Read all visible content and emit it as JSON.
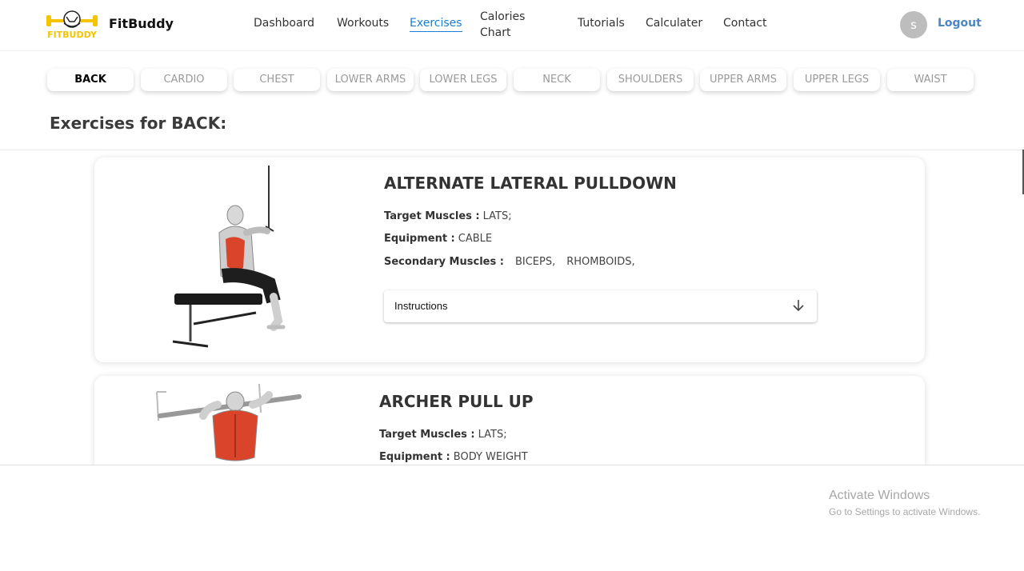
{
  "brand": {
    "name": "FitBuddy",
    "logo_text": "FITBUDDY"
  },
  "nav": {
    "items": [
      {
        "label": "Dashboard"
      },
      {
        "label": "Workouts"
      },
      {
        "label": "Exercises",
        "active": true
      },
      {
        "label": "Calories Chart"
      },
      {
        "label": "Tutorials"
      },
      {
        "label": "Calculater"
      },
      {
        "label": "Contact"
      }
    ],
    "avatar_initial": "s",
    "logout_label": "Logout"
  },
  "categories": [
    {
      "label": "BACK",
      "active": true
    },
    {
      "label": "CARDIO"
    },
    {
      "label": "CHEST"
    },
    {
      "label": "LOWER ARMS"
    },
    {
      "label": "LOWER LEGS"
    },
    {
      "label": "NECK"
    },
    {
      "label": "SHOULDERS"
    },
    {
      "label": "UPPER ARMS"
    },
    {
      "label": "UPPER LEGS"
    },
    {
      "label": "WAIST"
    }
  ],
  "section_title": "Exercises for BACK:",
  "labels": {
    "target": "Target Muscles :",
    "equipment": "Equipment :",
    "secondary": "Secondary Muscles :",
    "instructions": "Instructions"
  },
  "exercises": [
    {
      "name": "ALTERNATE LATERAL PULLDOWN",
      "target": "LATS;",
      "equipment": "CABLE",
      "secondary": [
        "BICEPS,",
        "RHOMBOIDS,"
      ]
    },
    {
      "name": "ARCHER PULL UP",
      "target": "LATS;",
      "equipment": "BODY WEIGHT"
    }
  ],
  "watermark": {
    "title": "Activate Windows",
    "subtitle": "Go to Settings to activate Windows."
  },
  "colors": {
    "accent": "#1a7fd4",
    "logout": "#4a86c5",
    "logo_yellow": "#f5c400",
    "muscle_red": "#d9442b"
  }
}
